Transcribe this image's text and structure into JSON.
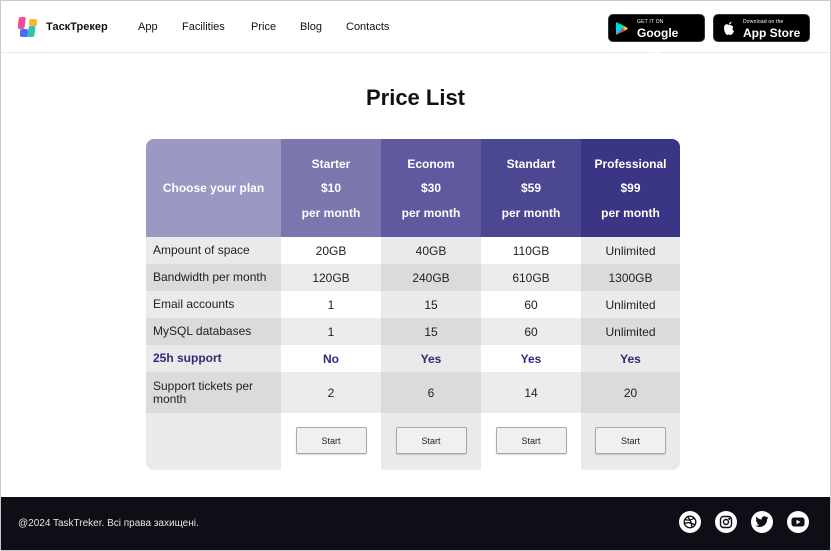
{
  "header": {
    "brand": "ТаскТрекер",
    "nav": [
      "App",
      "Facilities",
      "Price",
      "Blog",
      "Contacts"
    ],
    "google_play": {
      "small": "GET IT ON",
      "big": "Google Play"
    },
    "app_store": {
      "small": "Download on the",
      "big": "App Store"
    }
  },
  "page_title": "Price List",
  "pricing": {
    "corner_label": "Choose your plan",
    "plans": [
      {
        "name": "Starter",
        "price": "$10",
        "period": "per month",
        "color": "#7a76ae"
      },
      {
        "name": "Econom",
        "price": "$30",
        "period": "per month",
        "color": "#5f5aa0"
      },
      {
        "name": "Standart",
        "price": "$59",
        "period": "per month",
        "color": "#4c4791"
      },
      {
        "name": "Professional",
        "price": "$99",
        "period": "per month",
        "color": "#3a3584"
      }
    ],
    "rows": [
      {
        "label": "Ampount of space",
        "values": [
          "20GB",
          "40GB",
          "110GB",
          "Unlimited"
        ]
      },
      {
        "label": "Bandwidth per month",
        "values": [
          "120GB",
          "240GB",
          "610GB",
          "1300GB"
        ]
      },
      {
        "label": "Email accounts",
        "values": [
          "1",
          "15",
          "60",
          "Unlimited"
        ]
      },
      {
        "label": "MySQL databases",
        "values": [
          "1",
          "15",
          "60",
          "Unlimited"
        ]
      },
      {
        "label": "25h support",
        "values": [
          "No",
          "Yes",
          "Yes",
          "Yes"
        ],
        "highlight": true
      },
      {
        "label": "Support tickets per month",
        "values": [
          "2",
          "6",
          "14",
          "20"
        ]
      }
    ],
    "button_label": "Start",
    "colors": {
      "corner": "#9b98c4",
      "highlight_text": "#2f2b78"
    }
  },
  "footer": {
    "copyright": "@2024 TaskTreker. Всі права захищені.",
    "social": [
      "dribbble-icon",
      "instagram-icon",
      "twitter-icon",
      "youtube-icon"
    ]
  }
}
